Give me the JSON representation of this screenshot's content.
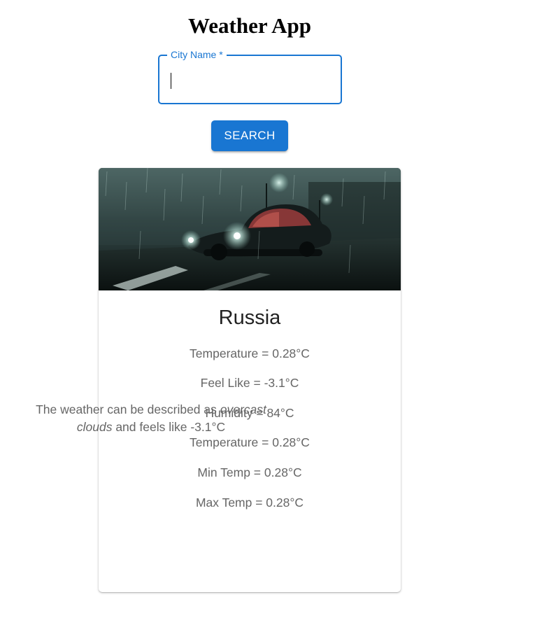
{
  "header": {
    "title": "Weather App"
  },
  "search": {
    "label": "City Name *",
    "value": "",
    "button_label": "SEARCH"
  },
  "result": {
    "city": "Russia",
    "stats": [
      "Temperature = 0.28°C",
      "Feel Like = -3.1°C",
      "Humidity = 84°C",
      "Temperature = 0.28°C",
      "Min Temp = 0.28°C",
      "Max Temp = 0.28°C"
    ],
    "description": {
      "prefix": "The weather can be described as ",
      "condition": "overcast clouds",
      "middle": " and feels like ",
      "feels_like": "-3.1°C"
    }
  },
  "colors": {
    "primary": "#1976d2",
    "text_secondary": "#666666"
  }
}
